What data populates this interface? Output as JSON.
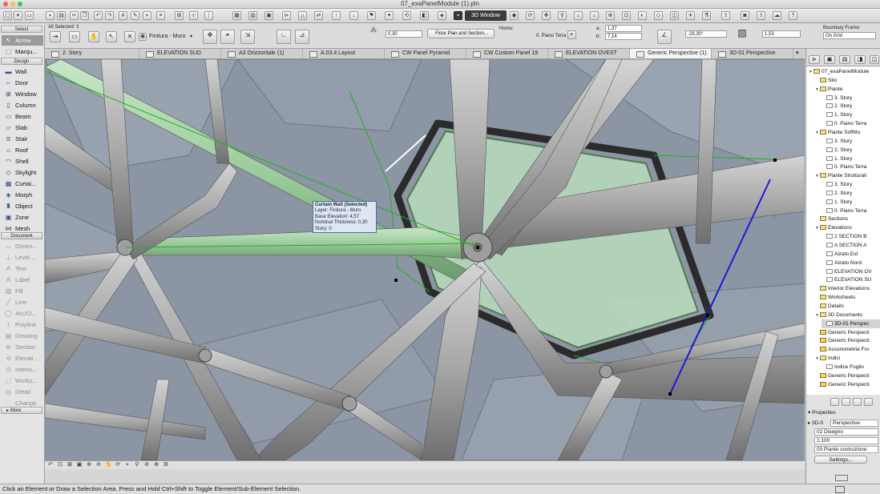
{
  "window": {
    "title": "07_exaPanelModule (1).pln"
  },
  "toolbar": {
    "view_button": "3D Window"
  },
  "infobox": {
    "selection_label": "All Selected: 3",
    "layer": "Finitura - Muro",
    "offset": "0,30",
    "display": "Floor Plan and Section...",
    "home_label": "Home:",
    "home_story": "0. Piano Terra",
    "a_label": "a:",
    "a_value": "1,37",
    "b_label": "b:",
    "b_value": "7,14",
    "angle": "-29,30°",
    "thickness": "1,53",
    "boundary_label": "Boundary Frame:",
    "boundary_value": "On Grid"
  },
  "tabs": [
    {
      "label": "2. Story"
    },
    {
      "label": "ELEVATION SUD"
    },
    {
      "label": "A3 Orizzontale (1)"
    },
    {
      "label": "A.03.4 Layout"
    },
    {
      "label": "CW Panel Pyramid"
    },
    {
      "label": "CW Custom Panel 19"
    },
    {
      "label": "ELEVATION OVEST"
    },
    {
      "label": "Generic Perspective (1)"
    },
    {
      "label": "3D-01 Perspective"
    }
  ],
  "toolbox": {
    "select_header": "Select",
    "design_header": "Design",
    "document_header": "Document",
    "more": "More",
    "select_tools": [
      {
        "label": "Arrow",
        "icon": "arrow-icon"
      },
      {
        "label": "Marqu...",
        "icon": "marquee-icon"
      }
    ],
    "design_tools": [
      {
        "label": "Wall",
        "icon": "wall-icon"
      },
      {
        "label": "Door",
        "icon": "door-icon"
      },
      {
        "label": "Window",
        "icon": "window-icon"
      },
      {
        "label": "Column",
        "icon": "column-icon"
      },
      {
        "label": "Beam",
        "icon": "beam-icon"
      },
      {
        "label": "Slab",
        "icon": "slab-icon"
      },
      {
        "label": "Stair",
        "icon": "stair-icon"
      },
      {
        "label": "Roof",
        "icon": "roof-icon"
      },
      {
        "label": "Shell",
        "icon": "shell-icon"
      },
      {
        "label": "Skylight",
        "icon": "skylight-icon"
      },
      {
        "label": "Curtai...",
        "icon": "curtain-wall-icon"
      },
      {
        "label": "Morph",
        "icon": "morph-icon"
      },
      {
        "label": "Object",
        "icon": "object-icon"
      },
      {
        "label": "Zone",
        "icon": "zone-icon"
      },
      {
        "label": "Mesh",
        "icon": "mesh-icon"
      }
    ],
    "document_tools": [
      {
        "label": "Dimen...",
        "icon": "dimension-icon"
      },
      {
        "label": "Level ...",
        "icon": "level-icon"
      },
      {
        "label": "Text",
        "icon": "text-icon"
      },
      {
        "label": "Label",
        "icon": "label-icon"
      },
      {
        "label": "Fill",
        "icon": "fill-icon"
      },
      {
        "label": "Line",
        "icon": "line-icon"
      },
      {
        "label": "Arc/Cl...",
        "icon": "arc-icon"
      },
      {
        "label": "Polyline",
        "icon": "polyline-icon"
      },
      {
        "label": "Drawing",
        "icon": "drawing-icon"
      },
      {
        "label": "Section",
        "icon": "section-icon"
      },
      {
        "label": "Elevati...",
        "icon": "elevation-icon"
      },
      {
        "label": "Interio...",
        "icon": "interior-elevation-icon"
      },
      {
        "label": "Works...",
        "icon": "worksheet-icon"
      },
      {
        "label": "Detail",
        "icon": "detail-icon"
      },
      {
        "label": "Change",
        "icon": "change-icon"
      }
    ]
  },
  "tooltip": {
    "title": "Curtain Wall (Selected)",
    "lines": [
      "Layer: Finitura - Muro",
      "Base Elevation: 4,57",
      "Nominal Thickness: 0,30",
      "Story: 0"
    ]
  },
  "navigator": {
    "items": [
      {
        "label": "07_exaPanelModule",
        "indent": 0,
        "type": "folder",
        "expanded": true
      },
      {
        "label": "Sito",
        "indent": 1,
        "type": "folder"
      },
      {
        "label": "Piante",
        "indent": 1,
        "type": "folder",
        "expanded": true
      },
      {
        "label": "3. Story",
        "indent": 2,
        "type": "doc"
      },
      {
        "label": "2. Story",
        "indent": 2,
        "type": "doc"
      },
      {
        "label": "1. Story",
        "indent": 2,
        "type": "doc"
      },
      {
        "label": "0. Piano Terra",
        "indent": 2,
        "type": "doc"
      },
      {
        "label": "Piante Soffitto",
        "indent": 1,
        "type": "folder",
        "expanded": true
      },
      {
        "label": "3. Story",
        "indent": 2,
        "type": "doc"
      },
      {
        "label": "2. Story",
        "indent": 2,
        "type": "doc"
      },
      {
        "label": "1. Story",
        "indent": 2,
        "type": "doc"
      },
      {
        "label": "0. Piano Terra",
        "indent": 2,
        "type": "doc"
      },
      {
        "label": "Piante Strutturali",
        "indent": 1,
        "type": "folder",
        "expanded": true
      },
      {
        "label": "3. Story",
        "indent": 2,
        "type": "doc"
      },
      {
        "label": "2. Story",
        "indent": 2,
        "type": "doc"
      },
      {
        "label": "1. Story",
        "indent": 2,
        "type": "doc"
      },
      {
        "label": "0. Piano Terra",
        "indent": 2,
        "type": "doc"
      },
      {
        "label": "Sections",
        "indent": 1,
        "type": "folder"
      },
      {
        "label": "Elevations",
        "indent": 1,
        "type": "folder",
        "expanded": true
      },
      {
        "label": "2 SECTION B",
        "indent": 2,
        "type": "doc"
      },
      {
        "label": "A SECTION A",
        "indent": 2,
        "type": "doc"
      },
      {
        "label": "Alzato Est",
        "indent": 2,
        "type": "doc"
      },
      {
        "label": "Alzato Nord",
        "indent": 2,
        "type": "doc"
      },
      {
        "label": "ELEVATION OV",
        "indent": 2,
        "type": "doc"
      },
      {
        "label": "ELEVATION SU",
        "indent": 2,
        "type": "doc"
      },
      {
        "label": "Interior Elevations",
        "indent": 1,
        "type": "folder"
      },
      {
        "label": "Worksheets",
        "indent": 1,
        "type": "folder"
      },
      {
        "label": "Details",
        "indent": 1,
        "type": "folder"
      },
      {
        "label": "3D Documents",
        "indent": 1,
        "type": "folder",
        "expanded": true
      },
      {
        "label": "3D-01 Perspec",
        "indent": 2,
        "type": "doc",
        "selected": true
      },
      {
        "label": "Generic Perspecti",
        "indent": 1,
        "type": "pers"
      },
      {
        "label": "Generic Perspecti",
        "indent": 1,
        "type": "pers"
      },
      {
        "label": "Assonometria Fro",
        "indent": 1,
        "type": "pers"
      },
      {
        "label": "Indici",
        "indent": 1,
        "type": "folder",
        "expanded": true
      },
      {
        "label": "Indice Foglio",
        "indent": 2,
        "type": "doc"
      },
      {
        "label": "Generic Perspecti",
        "indent": 1,
        "type": "pers"
      },
      {
        "label": "Generic Perspecti",
        "indent": 1,
        "type": "pers"
      }
    ]
  },
  "properties": {
    "header": "Properties",
    "view_id": "3D-0",
    "view_name": "Perspective",
    "drawing": "02 Disegno",
    "scale": "1:100",
    "layer_combo": "03 Piante costruzione",
    "settings_button": "Settings..."
  },
  "status": {
    "message": "Click an Element or Draw a Selection Area. Press and Hold Ctrl+Shift to Toggle Element/Sub-Element Selection."
  },
  "colors": {
    "viewport_bg": "#8c95a3",
    "panel": "#b9dcbd",
    "frame": "#2b2b2b",
    "strut": "#a7a7a7",
    "selection_green": "#1db31d",
    "guide_blue": "#1a1ad6"
  }
}
